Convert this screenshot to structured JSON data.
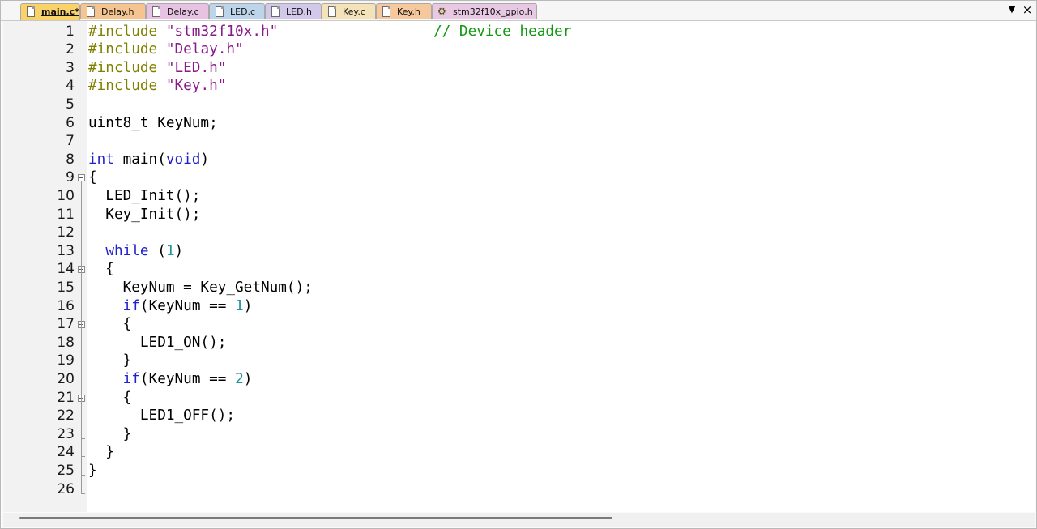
{
  "tabs": [
    {
      "label": "main.c*",
      "active": true,
      "color": "#f9d36a",
      "type": "file"
    },
    {
      "label": "Delay.h",
      "active": false,
      "color": "#f6c48e",
      "type": "file"
    },
    {
      "label": "Delay.c",
      "active": false,
      "color": "#e7c2e2",
      "type": "file"
    },
    {
      "label": "LED.c",
      "active": false,
      "color": "#bcd5ea",
      "type": "file"
    },
    {
      "label": "LED.h",
      "active": false,
      "color": "#d1c8ea",
      "type": "file"
    },
    {
      "label": "Key.c",
      "active": false,
      "color": "#f4e3b9",
      "type": "file"
    },
    {
      "label": "Key.h",
      "active": false,
      "color": "#f7c89b",
      "type": "file"
    },
    {
      "label": "stm32f10x_gpio.h",
      "active": false,
      "color": "#e8c8e3",
      "type": "gear"
    }
  ],
  "tab_controls": {
    "dropdown": "▼",
    "close": "×"
  },
  "lines": [
    {
      "n": "1",
      "tokens": [
        {
          "t": "#include ",
          "c": "pp"
        },
        {
          "t": "\"stm32f10x.h\"",
          "c": "str"
        },
        {
          "t": "                  ",
          "c": "plain"
        },
        {
          "t": "// Device header",
          "c": "cmt"
        }
      ]
    },
    {
      "n": "2",
      "tokens": [
        {
          "t": "#include ",
          "c": "pp"
        },
        {
          "t": "\"Delay.h\"",
          "c": "str"
        }
      ]
    },
    {
      "n": "3",
      "tokens": [
        {
          "t": "#include ",
          "c": "pp"
        },
        {
          "t": "\"LED.h\"",
          "c": "str"
        }
      ]
    },
    {
      "n": "4",
      "tokens": [
        {
          "t": "#include ",
          "c": "pp"
        },
        {
          "t": "\"Key.h\"",
          "c": "str"
        }
      ]
    },
    {
      "n": "5",
      "tokens": []
    },
    {
      "n": "6",
      "tokens": [
        {
          "t": "uint8_t KeyNum;",
          "c": "plain"
        }
      ]
    },
    {
      "n": "7",
      "tokens": []
    },
    {
      "n": "8",
      "tokens": [
        {
          "t": "int",
          "c": "kw"
        },
        {
          "t": " main(",
          "c": "plain"
        },
        {
          "t": "void",
          "c": "kw"
        },
        {
          "t": ")",
          "c": "plain"
        }
      ]
    },
    {
      "n": "9",
      "tokens": [
        {
          "t": "{",
          "c": "plain"
        }
      ],
      "fold": "open"
    },
    {
      "n": "10",
      "tokens": [
        {
          "t": "  LED_Init();",
          "c": "plain"
        }
      ]
    },
    {
      "n": "11",
      "tokens": [
        {
          "t": "  Key_Init();",
          "c": "plain"
        }
      ]
    },
    {
      "n": "12",
      "tokens": []
    },
    {
      "n": "13",
      "tokens": [
        {
          "t": "  ",
          "c": "plain"
        },
        {
          "t": "while",
          "c": "kw"
        },
        {
          "t": " (",
          "c": "plain"
        },
        {
          "t": "1",
          "c": "num"
        },
        {
          "t": ")",
          "c": "plain"
        }
      ]
    },
    {
      "n": "14",
      "tokens": [
        {
          "t": "  {",
          "c": "plain"
        }
      ],
      "fold": "open"
    },
    {
      "n": "15",
      "tokens": [
        {
          "t": "    KeyNum = Key_GetNum();",
          "c": "plain"
        }
      ]
    },
    {
      "n": "16",
      "tokens": [
        {
          "t": "    ",
          "c": "plain"
        },
        {
          "t": "if",
          "c": "kw"
        },
        {
          "t": "(KeyNum == ",
          "c": "plain"
        },
        {
          "t": "1",
          "c": "num"
        },
        {
          "t": ")",
          "c": "plain"
        }
      ]
    },
    {
      "n": "17",
      "tokens": [
        {
          "t": "    {",
          "c": "plain"
        }
      ],
      "fold": "open"
    },
    {
      "n": "18",
      "tokens": [
        {
          "t": "      LED1_ON();",
          "c": "plain"
        }
      ]
    },
    {
      "n": "19",
      "tokens": [
        {
          "t": "    }",
          "c": "plain"
        }
      ],
      "fold": "end"
    },
    {
      "n": "20",
      "tokens": [
        {
          "t": "    ",
          "c": "plain"
        },
        {
          "t": "if",
          "c": "kw"
        },
        {
          "t": "(KeyNum == ",
          "c": "plain"
        },
        {
          "t": "2",
          "c": "num"
        },
        {
          "t": ")",
          "c": "plain"
        }
      ]
    },
    {
      "n": "21",
      "tokens": [
        {
          "t": "    {",
          "c": "plain"
        }
      ],
      "fold": "open"
    },
    {
      "n": "22",
      "tokens": [
        {
          "t": "      LED1_OFF();",
          "c": "plain"
        }
      ]
    },
    {
      "n": "23",
      "tokens": [
        {
          "t": "    }",
          "c": "plain"
        }
      ],
      "fold": "end"
    },
    {
      "n": "24",
      "tokens": [
        {
          "t": "  }",
          "c": "plain"
        }
      ],
      "fold": "end"
    },
    {
      "n": "25",
      "tokens": [
        {
          "t": "}",
          "c": "plain"
        }
      ],
      "fold": "end"
    },
    {
      "n": "26",
      "tokens": [],
      "fold": "end"
    }
  ]
}
